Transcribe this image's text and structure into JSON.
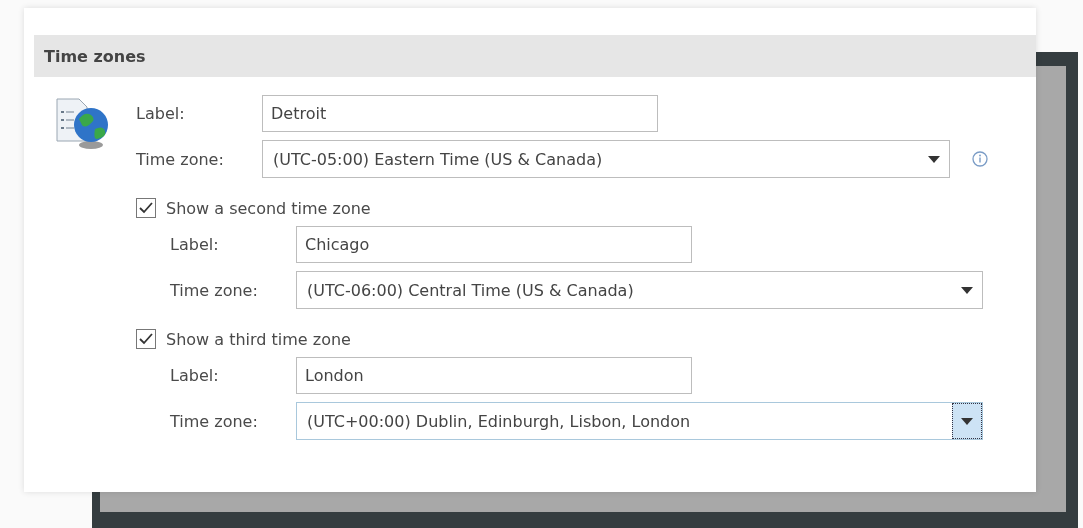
{
  "section": {
    "title": "Time zones"
  },
  "zones": [
    {
      "kind": "primary",
      "label_caption": "Label:",
      "label_value": "Detroit",
      "zone_caption": "Time zone:",
      "zone_value": "(UTC-05:00) Eastern Time (US & Canada)",
      "focused": false
    },
    {
      "kind": "extra",
      "checkbox": {
        "text": "Show a second time zone",
        "checked": true
      },
      "label_caption": "Label:",
      "label_value": "Chicago",
      "zone_caption": "Time zone:",
      "zone_value": "(UTC-06:00) Central Time (US & Canada)",
      "focused": false
    },
    {
      "kind": "extra",
      "checkbox": {
        "text": "Show a third time zone",
        "checked": true
      },
      "label_caption": "Label:",
      "label_value": "London",
      "zone_caption": "Time zone:",
      "zone_value": "(UTC+00:00) Dublin, Edinburgh, Lisbon, London",
      "focused": true
    }
  ]
}
